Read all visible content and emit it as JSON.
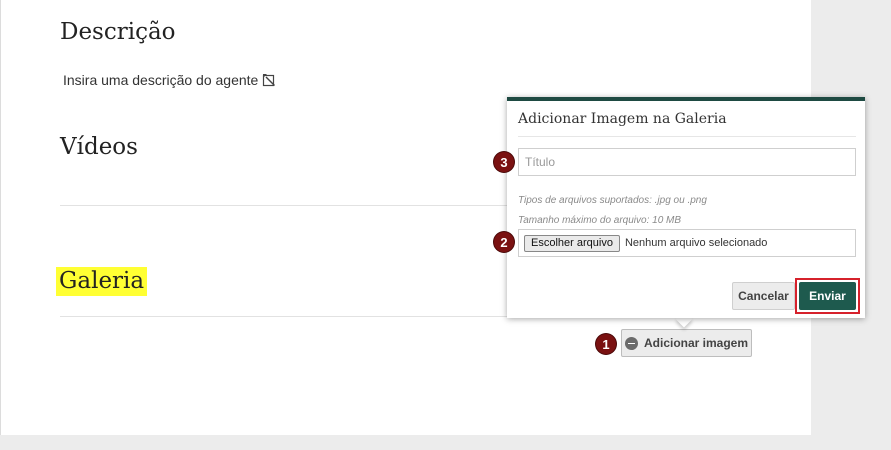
{
  "sections": {
    "descricao": {
      "title": "Descrição",
      "placeholder_text": "Insira uma descrição do agente"
    },
    "videos": {
      "title": "Vídeos"
    },
    "galeria": {
      "title": "Galeria",
      "add_button_label": "Adicionar imagem"
    }
  },
  "dialog": {
    "title": "Adicionar Imagem na Galeria",
    "title_field_placeholder": "Título",
    "hint_formats": "Tipos de arquivos suportados: .jpg ou .png",
    "hint_size": "Tamanho máximo do arquivo: 10 MB",
    "file_button_label": "Escolher arquivo",
    "file_status": "Nenhum arquivo selecionado",
    "cancel_label": "Cancelar",
    "send_label": "Enviar"
  },
  "annotations": {
    "step1": "1",
    "step2": "2",
    "step3": "3"
  },
  "colors": {
    "highlight": "#ffff33",
    "primary_button": "#1e5a4e",
    "dialog_border": "#1e4a42",
    "badge": "#7a1111",
    "callout_outline": "#d6212b"
  },
  "icons": [
    "edit-icon",
    "plus-circle-icon"
  ]
}
